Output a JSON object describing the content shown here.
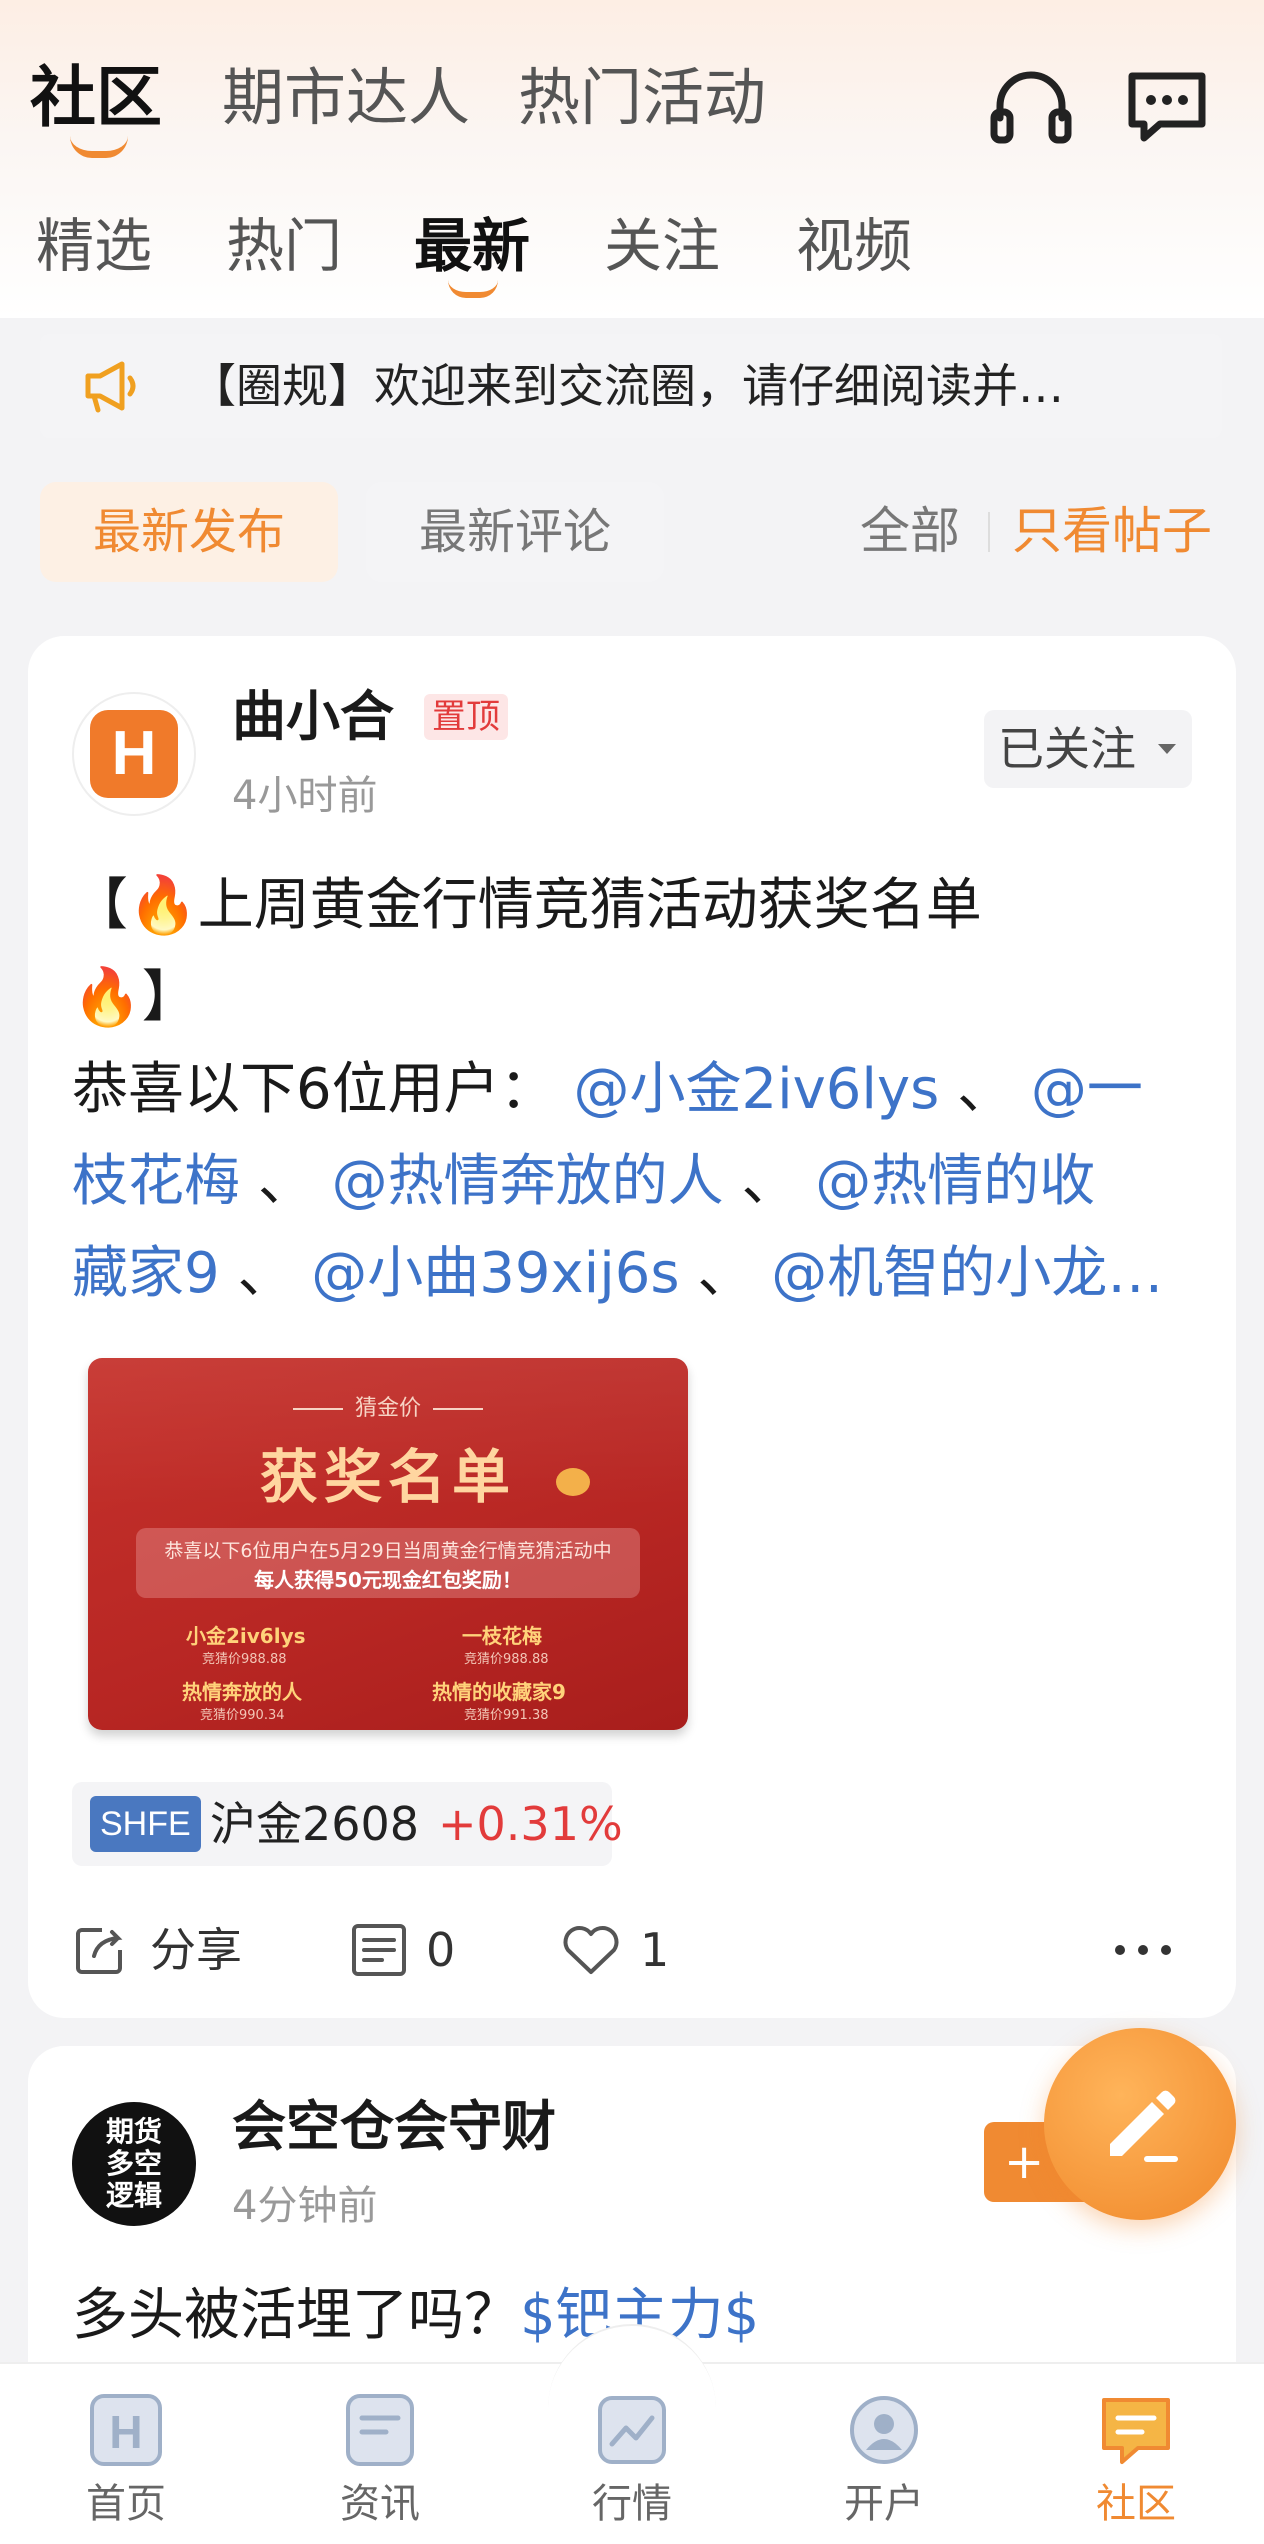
{
  "header": {
    "tabs": [
      "社区",
      "期市达人",
      "热门活动"
    ],
    "headset_icon": "headset-icon",
    "message_icon": "chat-icon"
  },
  "subtabs": [
    "精选",
    "热门",
    "最新",
    "关注",
    "视频"
  ],
  "notice": {
    "icon": "megaphone-icon",
    "text": "【圈规】欢迎来到交流圈，请仔细阅读并…"
  },
  "filters": {
    "sort_latest_post": "最新发布",
    "sort_latest_comment": "最新评论",
    "view_all": "全部",
    "view_posts_only": "只看帖子"
  },
  "post1": {
    "avatar_letter": "H",
    "username": "曲小合",
    "pinned_badge": "置顶",
    "time": "4小时前",
    "follow_label": "已关注",
    "title_open": "【",
    "title_main": "上周黄金行情竞猜活动获奖名单",
    "title_close": "】",
    "line2_prefix": "恭喜以下6位用户：",
    "m1": "@小金2iv6lys",
    "sep": "、",
    "m2a": "@一",
    "m2b": "枝花梅",
    "m3": "@热情奔放的人",
    "m4a": "@热情的收",
    "m4b": "藏家9",
    "m5": "@小曲39xij6s",
    "m6": "@机智的小龙…",
    "image": {
      "top_label": "猜金价",
      "title": "获奖名单",
      "desc1": "恭喜以下6位用户在5月29日当周黄金行情竞猜活动中",
      "desc2": "每人获得50元现金红包奖励！",
      "winners": [
        {
          "name": "小金2iv6lys",
          "guess": "竞猜价988.88"
        },
        {
          "name": "一枝花梅",
          "guess": "竞猜价988.88"
        },
        {
          "name": "热情奔放的人",
          "guess": "竞猜价990.34"
        },
        {
          "name": "热情的收藏家9",
          "guess": "竞猜价991.38"
        }
      ]
    },
    "stock": {
      "exchange": "SHFE",
      "name": "沪金2608",
      "change": "+0.31%"
    },
    "actions": {
      "share": "分享",
      "comments": "0",
      "likes": "1"
    }
  },
  "post2": {
    "avatar_text": [
      "期货",
      "多空",
      "逻辑"
    ],
    "username": "会空仓会守财",
    "time": "4分钟前",
    "add_label": "+",
    "text_prefix": "多头被活埋了吗？",
    "tag": "$钯主力$"
  },
  "tabbar": {
    "items": [
      {
        "label": "首页",
        "icon": "home-icon"
      },
      {
        "label": "资讯",
        "icon": "news-icon"
      },
      {
        "label": "行情",
        "icon": "chart-icon"
      },
      {
        "label": "开户",
        "icon": "account-icon"
      },
      {
        "label": "社区",
        "icon": "community-icon"
      }
    ]
  },
  "colors": {
    "accent": "#f08a32",
    "link": "#3d73c8",
    "up": "#e23b3b"
  }
}
